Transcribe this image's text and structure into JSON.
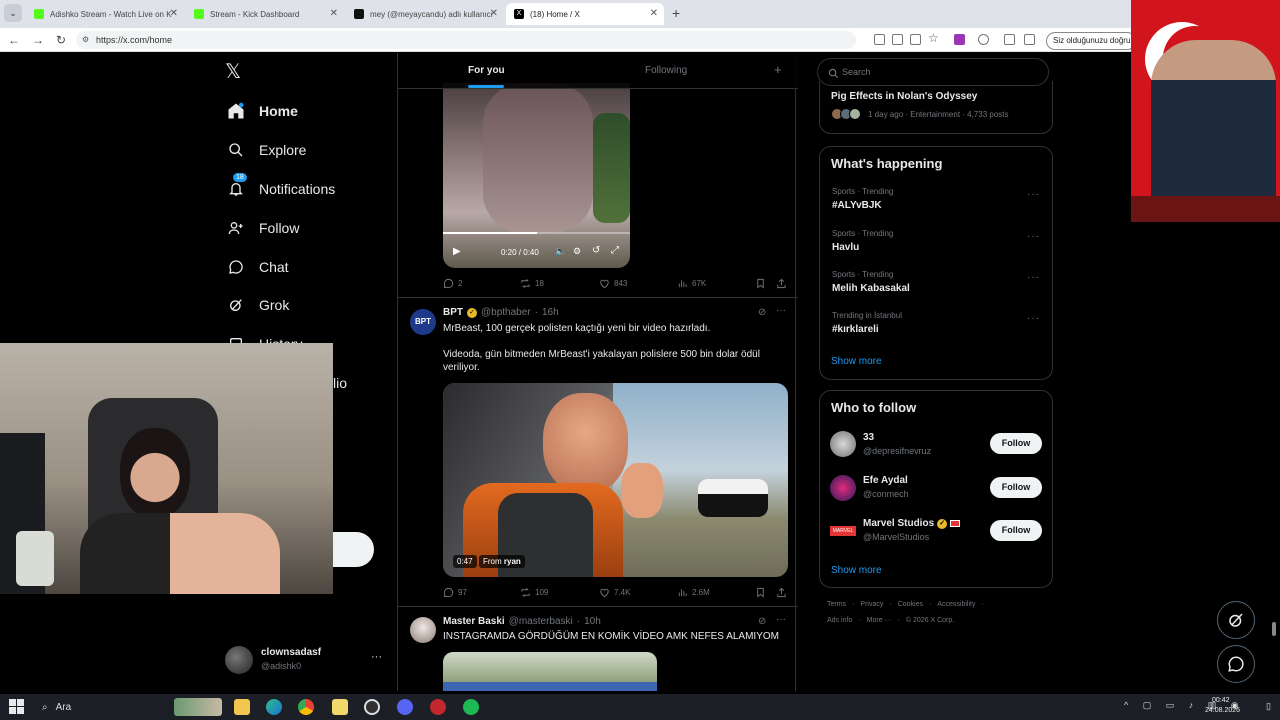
{
  "browser": {
    "tabs": [
      {
        "label": "Adishko Stream - Watch Live on K",
        "color": "#53fc18"
      },
      {
        "label": "Stream - Kick Dashboard",
        "color": "#53fc18"
      },
      {
        "label": "mey (@meyaycandu) adlı kullanıcı",
        "color": "#111111"
      },
      {
        "label": "(18) Home / X",
        "color": "#000000"
      }
    ],
    "new_tab": "+",
    "url": "https://x.com/home",
    "translate_chip": "Siz olduğunuzu doğru"
  },
  "sidebar": {
    "logo": "𝕏",
    "items": [
      {
        "label": "Home",
        "icon": "home-icon"
      },
      {
        "label": "Explore",
        "icon": "search-icon"
      },
      {
        "label": "Notifications",
        "icon": "bell-icon",
        "badge": "18"
      },
      {
        "label": "Follow",
        "icon": "person-add-icon"
      },
      {
        "label": "Chat",
        "icon": "chat-icon"
      },
      {
        "label": "Grok",
        "icon": "grok-icon"
      },
      {
        "label": "History",
        "icon": "history-icon"
      }
    ],
    "partial_label": "lio",
    "profile": {
      "name": "clownsadasf",
      "handle": "@adishk0",
      "more": "···"
    }
  },
  "timeline": {
    "tabs": {
      "for_you": "For you",
      "following": "Following",
      "add": "+"
    },
    "post1": {
      "time": "0:20 / 0:40",
      "actions": {
        "replies": "2",
        "reposts": "18",
        "likes": "843",
        "views": "67K"
      }
    },
    "post2": {
      "name": "BPT",
      "handle": "@bpthaber",
      "time": "16h",
      "avatar_text": "BPT",
      "text1": "MrBeast, 100 gerçek polisten kaçtığı yeni bir video hazırladı.",
      "text2": "Videoda, gün bitmeden MrBeast'i yakalayan polislere 500 bin dolar ödül veriliyor.",
      "duration": "0:47",
      "from_label": "From",
      "from_user": "ryan",
      "actions": {
        "replies": "97",
        "reposts": "109",
        "likes": "7.4K",
        "views": "2.6M"
      }
    },
    "post3": {
      "name": "Master Baski",
      "handle": "@masterbaski",
      "time": "10h",
      "text": "INSTAGRAMDA GÖRDÜĞÜM EN KOMİK VİDEO AMK NEFES ALAMIYOM"
    }
  },
  "right": {
    "search_placeholder": "Search",
    "top_trend": {
      "title": "Pig Effects in Nolan's Odyssey",
      "meta": "1 day ago · Entertainment · 4,733 posts"
    },
    "whats_happening": {
      "title": "What's happening",
      "trends": [
        {
          "meta": "Sports · Trending",
          "name": "#ALYvBJK"
        },
        {
          "meta": "Sports · Trending",
          "name": "Havlu"
        },
        {
          "meta": "Sports · Trending",
          "name": "Melih Kabasakal"
        },
        {
          "meta": "Trending in İstanbul",
          "name": "#kırklareli"
        }
      ],
      "show_more": "Show more"
    },
    "who_to_follow": {
      "title": "Who to follow",
      "accounts": [
        {
          "name": "33",
          "handle": "@depresifnevruz",
          "button": "Follow"
        },
        {
          "name": "Efe Aydal",
          "handle": "@conmech",
          "button": "Follow"
        },
        {
          "name": "Marvel Studios",
          "handle": "@MarvelStudios",
          "button": "Follow"
        }
      ],
      "show_more": "Show more"
    },
    "footer": {
      "line1": [
        "Terms",
        "Privacy",
        "Cookies",
        "Accessibility"
      ],
      "line2": [
        "Ads info",
        "More ···",
        "© 2026 X Corp."
      ]
    }
  },
  "taskbar": {
    "search_label": "Ara",
    "clock_time": "00:42",
    "clock_date": "24.08.2026"
  },
  "colors": {
    "accent": "#1d9bf0",
    "follow_bg": "#eff3f4",
    "border": "#2f3336",
    "muted": "#71767b",
    "verified": "#e8b829",
    "tab_indicator": "#1d9bf0"
  }
}
